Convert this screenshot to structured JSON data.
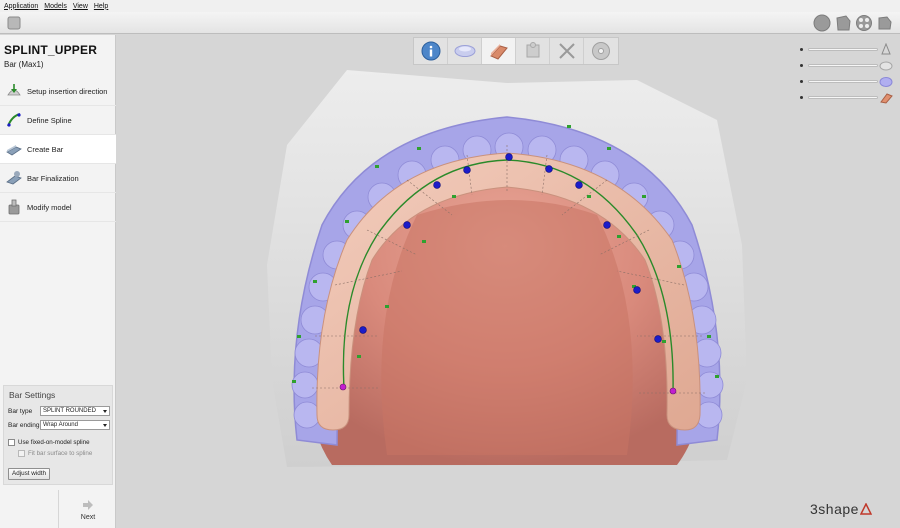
{
  "menu": [
    "Application",
    "Models",
    "View",
    "Help"
  ],
  "toolbar": {
    "right_icons": [
      "view-sphere-icon",
      "view-cube-icon",
      "view-orbit-icon",
      "view-box-icon"
    ]
  },
  "project": {
    "title": "SPLINT_UPPER",
    "subtitle": "Bar (Max1)"
  },
  "steps": [
    {
      "label": "Setup insertion direction",
      "icon": "insertion-direction-icon",
      "active": false
    },
    {
      "label": "Define Spline",
      "icon": "spline-icon",
      "active": false
    },
    {
      "label": "Create Bar",
      "icon": "bar-icon",
      "active": true
    },
    {
      "label": "Bar Finalization",
      "icon": "bar-finalization-icon",
      "active": false
    },
    {
      "label": "Modify model",
      "icon": "modify-model-icon",
      "active": false
    }
  ],
  "bar_settings": {
    "title": "Bar Settings",
    "bar_type_label": "Bar type",
    "bar_type_value": "SPLINT ROUNDED",
    "bar_ending_label": "Bar ending",
    "bar_ending_value": "Wrap Around",
    "fixed_spline_label": "Use fixed-on-model spline",
    "fit_surface_label": "Fit bar surface to spline",
    "adjust_width_label": "Adjust width"
  },
  "nav": {
    "next_label": "Next"
  },
  "wizard": [
    "info-icon",
    "scan-icon",
    "bar-icon",
    "puzzle-icon",
    "tools-icon",
    "disc-icon"
  ],
  "visibility_sliders": [
    {
      "icon": "tooth-scan-icon",
      "level": 1.0
    },
    {
      "icon": "gray-model-icon",
      "level": 1.0
    },
    {
      "icon": "purple-model-icon",
      "level": 1.0
    },
    {
      "icon": "bar-model-icon",
      "level": 1.0
    }
  ],
  "logo": {
    "text": "3shape",
    "icon": "3shape-triangle-icon"
  },
  "colors": {
    "teeth": "#a7a5e8",
    "bar": "#e9b9a5",
    "palate": "#d98a7c",
    "spline": "#2a8a2a",
    "control_point": "#1c1cc9",
    "end_point": "#c21fcf"
  }
}
